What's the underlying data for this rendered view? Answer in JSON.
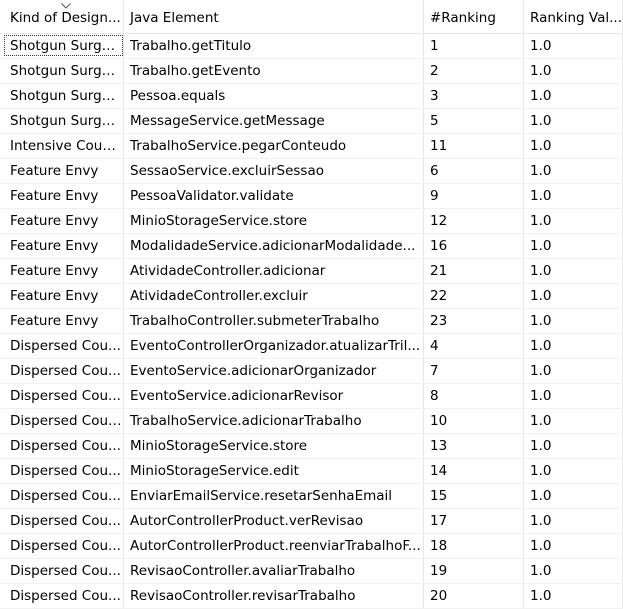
{
  "columns": [
    "Kind of Design Smell",
    "Java Element",
    "#Ranking",
    "Ranking Value"
  ],
  "column_display": [
    "Kind of Design...",
    "Java Element",
    "#Ranking",
    "Ranking Val..."
  ],
  "rows": [
    {
      "kind": "Shotgun Surgery",
      "element": "Trabalho.getTitulo",
      "rank": "1",
      "value": "1.0"
    },
    {
      "kind": "Shotgun Surgery",
      "element": "Trabalho.getEvento",
      "rank": "2",
      "value": "1.0"
    },
    {
      "kind": "Shotgun Surgery",
      "element": "Pessoa.equals",
      "rank": "3",
      "value": "1.0"
    },
    {
      "kind": "Shotgun Surgery",
      "element": "MessageService.getMessage",
      "rank": "5",
      "value": "1.0"
    },
    {
      "kind": "Intensive Coupl...",
      "element": "TrabalhoService.pegarConteudo",
      "rank": "11",
      "value": "1.0"
    },
    {
      "kind": "Feature Envy",
      "element": "SessaoService.excluirSessao",
      "rank": "6",
      "value": "1.0"
    },
    {
      "kind": "Feature Envy",
      "element": "PessoaValidator.validate",
      "rank": "9",
      "value": "1.0"
    },
    {
      "kind": "Feature Envy",
      "element": "MinioStorageService.store",
      "rank": "12",
      "value": "1.0"
    },
    {
      "kind": "Feature Envy",
      "element": "ModalidadeService.adicionarModalidade...",
      "rank": "16",
      "value": "1.0"
    },
    {
      "kind": "Feature Envy",
      "element": "AtividadeController.adicionar",
      "rank": "21",
      "value": "1.0"
    },
    {
      "kind": "Feature Envy",
      "element": "AtividadeController.excluir",
      "rank": "22",
      "value": "1.0"
    },
    {
      "kind": "Feature Envy",
      "element": "TrabalhoController.submeterTrabalho",
      "rank": "23",
      "value": "1.0"
    },
    {
      "kind": "Dispersed Cou...",
      "element": "EventoControllerOrganizador.atualizarTril...",
      "rank": "4",
      "value": "1.0"
    },
    {
      "kind": "Dispersed Cou...",
      "element": "EventoService.adicionarOrganizador",
      "rank": "7",
      "value": "1.0"
    },
    {
      "kind": "Dispersed Cou...",
      "element": "EventoService.adicionarRevisor",
      "rank": "8",
      "value": "1.0"
    },
    {
      "kind": "Dispersed Coupl...",
      "element": "TrabalhoService.adicionarTrabalho",
      "rank": "10",
      "value": "1.0"
    },
    {
      "kind": "Dispersed Cou...",
      "element": "MinioStorageService.store",
      "rank": "13",
      "value": "1.0"
    },
    {
      "kind": "Dispersed Cou...",
      "element": "MinioStorageService.edit",
      "rank": "14",
      "value": "1.0"
    },
    {
      "kind": "Dispersed Cou...",
      "element": "EnviarEmailService.resetarSenhaEmail",
      "rank": "15",
      "value": "1.0"
    },
    {
      "kind": "Dispersed Cou...",
      "element": "AutorControllerProduct.verRevisao",
      "rank": "17",
      "value": "1.0"
    },
    {
      "kind": "Dispersed Cou...",
      "element": "AutorControllerProduct.reenviarTrabalhoF...",
      "rank": "18",
      "value": "1.0"
    },
    {
      "kind": "Dispersed Cou...",
      "element": "RevisaoController.avaliarTrabalho",
      "rank": "19",
      "value": "1.0"
    },
    {
      "kind": "Dispersed Cou...",
      "element": "RevisaoController.revisarTrabalho",
      "rank": "20",
      "value": "1.0"
    }
  ],
  "sort_icon": "chevron-down-icon"
}
